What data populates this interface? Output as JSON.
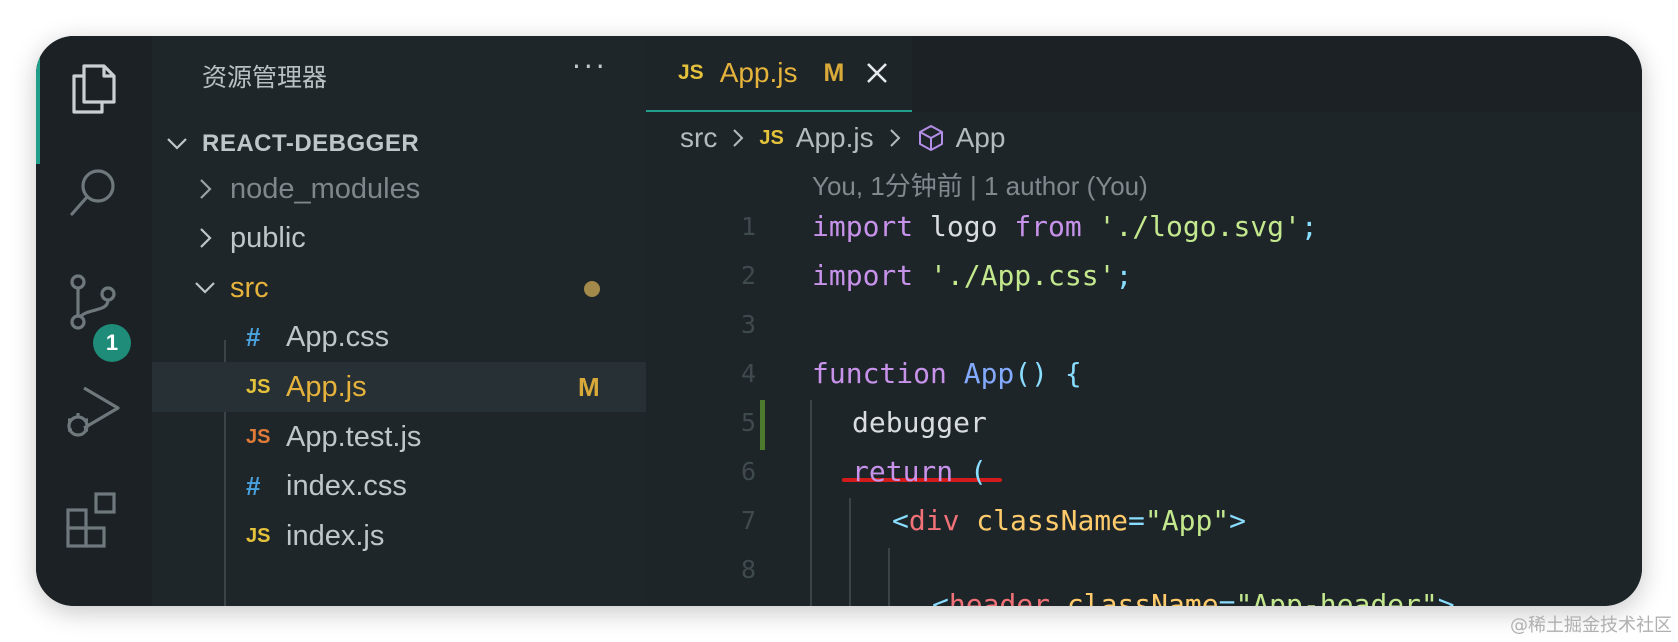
{
  "sidebar": {
    "title": "资源管理器",
    "more": "···",
    "project": "REACT-DEBGGER",
    "items": [
      {
        "icon": "",
        "label": "node_modules",
        "color": "#7e878b"
      },
      {
        "icon": "",
        "label": "public",
        "color": "#bfc6ca"
      },
      {
        "icon": "",
        "label": "src",
        "color": "#e5b33c"
      },
      {
        "icon": "#",
        "label": "App.css",
        "color": "#bfc6ca",
        "icon_color": "#4aa3df"
      },
      {
        "icon": "JS",
        "label": "App.js",
        "color": "#e5b33c",
        "icon_color": "#e5c23c",
        "badge": "M"
      },
      {
        "icon": "JS",
        "label": "App.test.js",
        "color": "#bfc6ca",
        "icon_color": "#e07b39"
      },
      {
        "icon": "#",
        "label": "index.css",
        "color": "#bfc6ca",
        "icon_color": "#4aa3df"
      },
      {
        "icon": "JS",
        "label": "index.js",
        "color": "#bfc6ca",
        "icon_color": "#e5c23c"
      }
    ]
  },
  "activity": {
    "scm_badge": "1",
    "icons": [
      "files-icon",
      "search-icon",
      "source-control-icon",
      "run-debug-icon",
      "extensions-icon"
    ]
  },
  "tab": {
    "type": "JS",
    "name": "App.js",
    "status": "M"
  },
  "breadcrumb": {
    "folder": "src",
    "file_type": "JS",
    "file": "App.js",
    "symbol": "App"
  },
  "blame": "You, 1分钟前 | 1 author (You)",
  "code": {
    "lines": [
      {
        "n": "1"
      },
      {
        "n": "2"
      },
      {
        "n": "3"
      },
      {
        "n": "4"
      },
      {
        "n": "5"
      },
      {
        "n": "6"
      },
      {
        "n": "7"
      },
      {
        "n": "8"
      }
    ],
    "l1": {
      "kw1": "import",
      "id": " logo ",
      "kw2": "from",
      "sp": " ",
      "str": "'./logo.svg'",
      "semi": ";"
    },
    "l2": {
      "kw": "import",
      "sp": " ",
      "str": "'./App.css'",
      "semi": ";"
    },
    "l4": {
      "kw": "function",
      "sp": " ",
      "fn": "App",
      "paren": "()",
      "sp2": " ",
      "brace": "{"
    },
    "l5": {
      "stmt": "debugger"
    },
    "l6": {
      "kw": "return",
      "sp": " ",
      "paren": "("
    },
    "l7": {
      "lt": "<",
      "tag": "div",
      "sp": " ",
      "attr": "className",
      "eq": "=",
      "str": "\"App\"",
      "gt": ">"
    },
    "l8": {
      "lt": "<",
      "tag": "header",
      "sp": " ",
      "attr": "className",
      "eq": "=",
      "str": "\"App-header\"",
      "gt": ">"
    }
  },
  "colors": {
    "accent": "#1f9e8a",
    "modified": "#d9a93a",
    "debugger_underline": "#d21c1c"
  },
  "watermark": "@稀土掘金技术社区"
}
